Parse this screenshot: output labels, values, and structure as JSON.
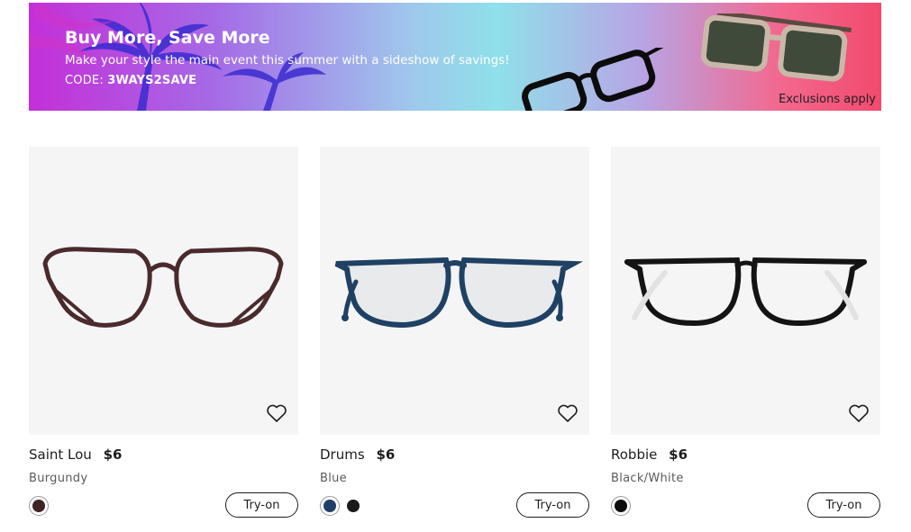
{
  "banner": {
    "title": "Buy More, Save More",
    "subtitle": "Make your style the main event this summer with a sideshow of savings!",
    "code_label": "CODE:",
    "code_value": "3WAYS2SAVE",
    "exclusions": "Exclusions apply"
  },
  "products": [
    {
      "name": "Saint Lou",
      "price": "$6",
      "color": "Burgundy",
      "frame_color": "#4a2a2c",
      "swatches": [
        "#3e2424"
      ],
      "tryon_label": "Try-on"
    },
    {
      "name": "Drums",
      "price": "$6",
      "color": "Blue",
      "frame_color": "#1f4163",
      "swatches": [
        "#1e3f66",
        "#1a1a1a"
      ],
      "tryon_label": "Try-on"
    },
    {
      "name": "Robbie",
      "price": "$6",
      "color": "Black/White",
      "frame_color": "#141414",
      "swatches": [
        "#0d0d0d"
      ],
      "tryon_label": "Try-on"
    }
  ],
  "icons": {
    "favorite": "heart-outline-icon"
  }
}
